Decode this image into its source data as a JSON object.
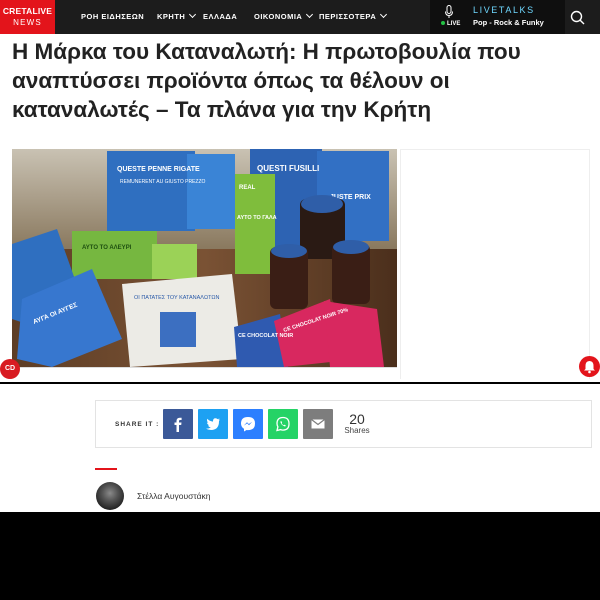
{
  "logo": {
    "line1": "CRETALIVE",
    "line2": "NEWS"
  },
  "nav": {
    "items": [
      {
        "label": "ΡΟΗ ΕΙΔΗΣΕΩΝ",
        "dropdown": false
      },
      {
        "label": "ΚΡΗΤΗ",
        "dropdown": true
      },
      {
        "label": "ΕΛΛΑΔΑ",
        "dropdown": false
      },
      {
        "label": "ΟΙΚΟΝΟΜΙΑ",
        "dropdown": true
      },
      {
        "label": "ΠΕΡΙΣΣΟΤΕΡΑ",
        "dropdown": true
      }
    ]
  },
  "livetalks": {
    "status": "LIVE",
    "title": "LIVETALKS",
    "subtitle": "Pop - Rock & Funky",
    "icon": "microphone-icon"
  },
  "search": {
    "icon": "search-icon"
  },
  "article": {
    "headline": "Η Μάρκα του Καταναλωτή: Η πρωτοβουλία που αναπτύσσει προϊόντα όπως τα θέλουν οι καταναλωτές – Τα πλάνα για την Κρήτη",
    "hero_labels": {
      "pasta": "QUESTE PENNE RIGATE",
      "pasta_sub": "REMUNERENT AU GIUSTO PREZZO",
      "fusilli": "QUESTI FUSILLI",
      "milk": "ΑΥΤΟ ΤΟ ΓΑΛΑ",
      "flour": "ΑΥΤΟ ΤΟ ΑΛΕΥΡΙ",
      "potatoes": "ΟΙ ΠΑΤΑΤΕΣ ΤΟΥ ΚΑΤΑΝΑΛΩΤΩΝ",
      "eggs": "ΑΥΓΑ ΟΙ ΑΥΓΕΣ",
      "chocolate1": "CE CHOCOLAT NOIR",
      "chocolate2": "CE CHOCOLAT NOIR 70%",
      "juste": "JUSTE PRIX",
      "real": "REAL"
    }
  },
  "badges": {
    "cd": "CD"
  },
  "share": {
    "label": "SHARE IT :",
    "buttons": [
      {
        "name": "facebook",
        "color": "#3b5998"
      },
      {
        "name": "twitter",
        "color": "#1da1f2"
      },
      {
        "name": "messenger",
        "color": "#2c7fff"
      },
      {
        "name": "whatsapp",
        "color": "#25d366"
      },
      {
        "name": "email",
        "color": "#7d7d7d"
      }
    ],
    "count": "20",
    "count_label": "Shares"
  },
  "author": {
    "name": "Στέλλα Αυγουστάκη"
  },
  "colors": {
    "brand": "#e3141b",
    "nav_bg": "#1c1c1c",
    "live_accent": "#6fd8ff"
  }
}
